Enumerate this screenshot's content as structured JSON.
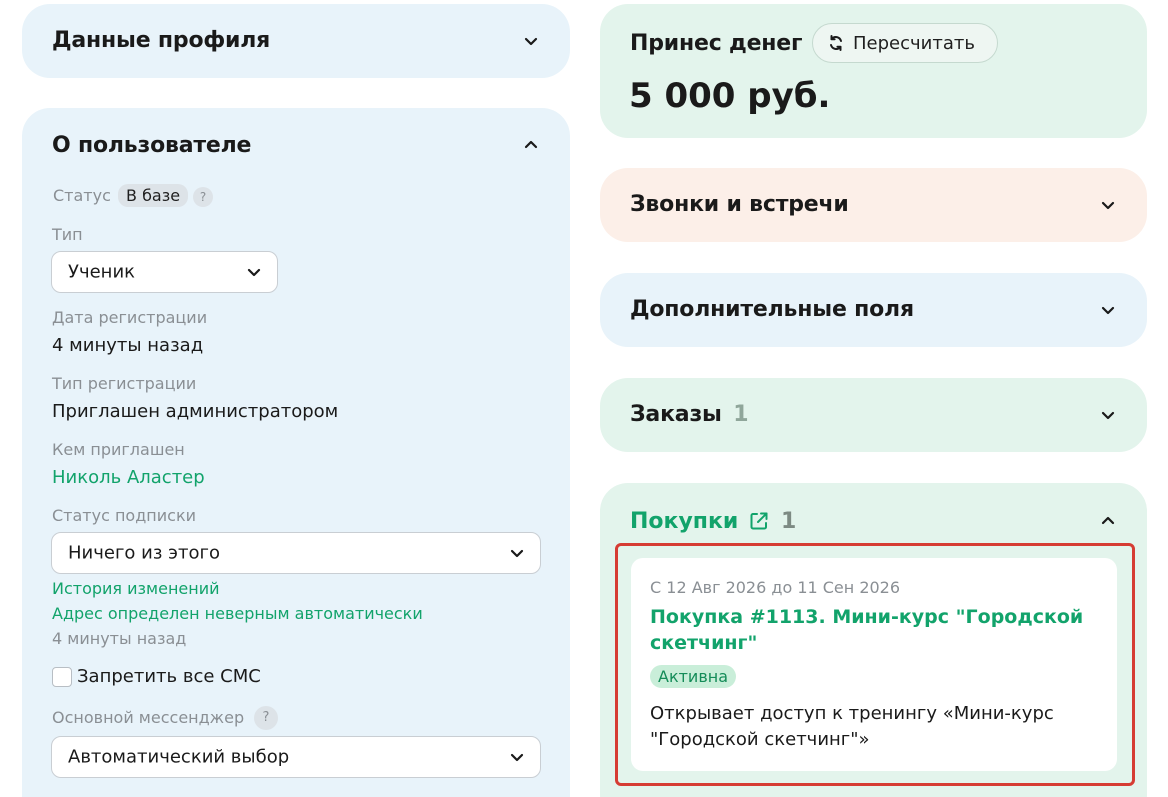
{
  "profile_card": {
    "title": "Данные профиля"
  },
  "about_card": {
    "title": "О пользователе",
    "status_label": "Статус",
    "status_value": "В базе",
    "help_mark": "?",
    "type_label": "Тип",
    "type_value": "Ученик",
    "reg_date_label": "Дата регистрации",
    "reg_date_value": "4 минуты назад",
    "reg_type_label": "Тип регистрации",
    "reg_type_value": "Приглашен администратором",
    "invited_by_label": "Кем приглашен",
    "invited_by_value": "Николь Аластер",
    "subscription_label": "Статус подписки",
    "subscription_value": "Ничего из этого",
    "history_link": "История изменений",
    "address_link": "Адрес определен неверным автоматически",
    "address_time": "4 минуты назад",
    "sms_checkbox_label": "Запретить все СМС",
    "sms_checked": false,
    "messenger_label": "Основной мессенджер",
    "messenger_value": "Автоматический выбор"
  },
  "money_card": {
    "title": "Принес денег",
    "recalc_label": "Пересчитать",
    "amount": "5 000 руб."
  },
  "calls_card": {
    "title": "Звонки и встречи"
  },
  "extra_fields_card": {
    "title": "Дополнительные поля"
  },
  "orders_card": {
    "title": "Заказы",
    "count": "1"
  },
  "purchases_card": {
    "title": "Покупки",
    "count": "1",
    "items": [
      {
        "period": "С 12 Авг 2026 до 11 Сен 2026",
        "title_line1": "Покупка #1113. Мини-курс \"Городской",
        "title_line2": "скетчинг\"",
        "status": "Активна",
        "desc_line1": "Открывает доступ к тренингу «Мини-курс",
        "desc_line2": "\"Городской скетчинг\"»"
      }
    ]
  },
  "colors": {
    "accent_green": "#12a36b",
    "card_blue": "#e8f3fa",
    "card_green": "#e3f4ec",
    "card_peach": "#fcefe8",
    "highlight_red": "#d63c33"
  },
  "icons": {
    "chevron_down": "chevron-down-icon",
    "chevron_up": "chevron-up-icon",
    "refresh": "refresh-icon",
    "external_link": "external-link-icon",
    "help": "help-icon"
  }
}
